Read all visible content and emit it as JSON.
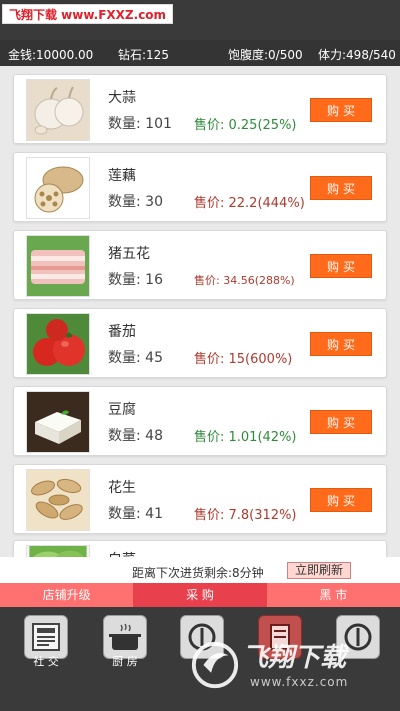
{
  "watermark_top": "飞翔下载 www.FXXZ.com",
  "stats": {
    "money": "金钱:10000.00",
    "diamond": "钻石:125",
    "fullness": "饱腹度:0/500",
    "stamina": "体力:498/540"
  },
  "items": [
    {
      "name": "大蒜",
      "qty": "数量: 101",
      "price": "售价: 0.25(25%)",
      "price_color": "green",
      "buy": "购买",
      "icon": "garlic-icon"
    },
    {
      "name": "莲藕",
      "qty": "数量: 30",
      "price": "售价: 22.2(444%)",
      "price_color": "red",
      "buy": "购买",
      "icon": "lotus-root-icon"
    },
    {
      "name": "猪五花",
      "qty": "数量: 16",
      "price": "售价: 34.56(288%)",
      "price_color": "red",
      "buy": "购买",
      "icon": "pork-belly-icon"
    },
    {
      "name": "番茄",
      "qty": "数量: 45",
      "price": "售价: 15(600%)",
      "price_color": "red",
      "buy": "购买",
      "icon": "tomato-icon"
    },
    {
      "name": "豆腐",
      "qty": "数量: 48",
      "price": "售价: 1.01(42%)",
      "price_color": "green",
      "buy": "购买",
      "icon": "tofu-icon"
    },
    {
      "name": "花生",
      "qty": "数量: 41",
      "price": "售价: 7.8(312%)",
      "price_color": "red",
      "buy": "购买",
      "icon": "peanut-icon"
    },
    {
      "name": "白菜",
      "icon": "cabbage-icon"
    }
  ],
  "restock": {
    "text": "距离下次进货剩余:8分钟",
    "refresh_label": "立即刷新"
  },
  "tabs": [
    {
      "label": "店铺升级",
      "active": false
    },
    {
      "label": "采 购",
      "active": true
    },
    {
      "label": "黑 市",
      "active": false
    }
  ],
  "nav": [
    {
      "label": "社 交",
      "icon": "newspaper-icon"
    },
    {
      "label": "厨 房",
      "icon": "cooking-pot-icon"
    },
    {
      "label": "",
      "icon": "plate-cutlery-icon"
    },
    {
      "label": "",
      "icon": "sign-icon"
    },
    {
      "label": "",
      "icon": "plate-cutlery-icon"
    }
  ],
  "brand": {
    "name": "飞翔下载",
    "url": "www.fxxz.com"
  },
  "colors": {
    "buy_button": "#ff6b1a",
    "tab_bar": "#ff7070",
    "tab_active": "#e8404c",
    "price_green": "#2e8b3a",
    "price_red": "#b03a2e"
  }
}
